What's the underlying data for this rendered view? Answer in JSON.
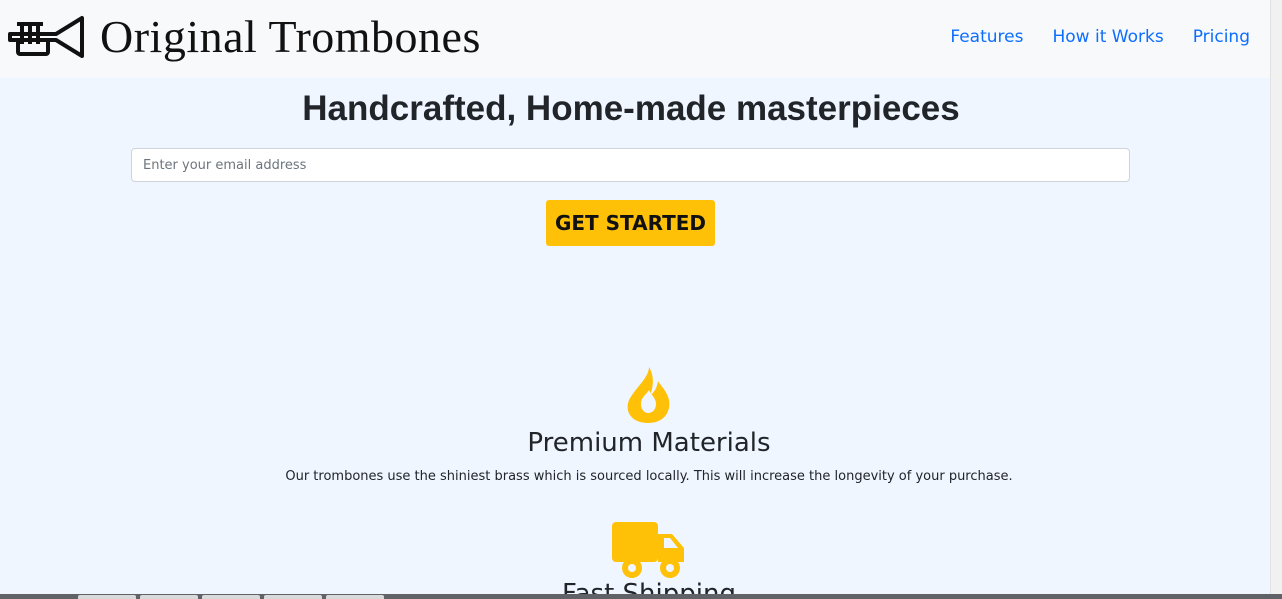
{
  "header": {
    "logo_text": "Original Trombones",
    "logo_icon": "trumpet-icon",
    "nav": [
      {
        "label": "Features"
      },
      {
        "label": "How it Works"
      },
      {
        "label": "Pricing"
      }
    ]
  },
  "hero": {
    "title": "Handcrafted, Home-made masterpieces",
    "email_placeholder": "Enter your email address",
    "email_value": "",
    "cta_label": "GET STARTED"
  },
  "features": [
    {
      "icon": "fire-icon",
      "title": "Premium Materials",
      "description": "Our trombones use the shiniest brass which is sourced locally. This will increase the longevity of your purchase."
    },
    {
      "icon": "truck-icon",
      "title": "Fast Shipping",
      "description": ""
    }
  ],
  "colors": {
    "accent": "#ffc107",
    "link": "#0d6efd",
    "background": "#eff6ff",
    "header_bg": "#f8f9fa"
  }
}
